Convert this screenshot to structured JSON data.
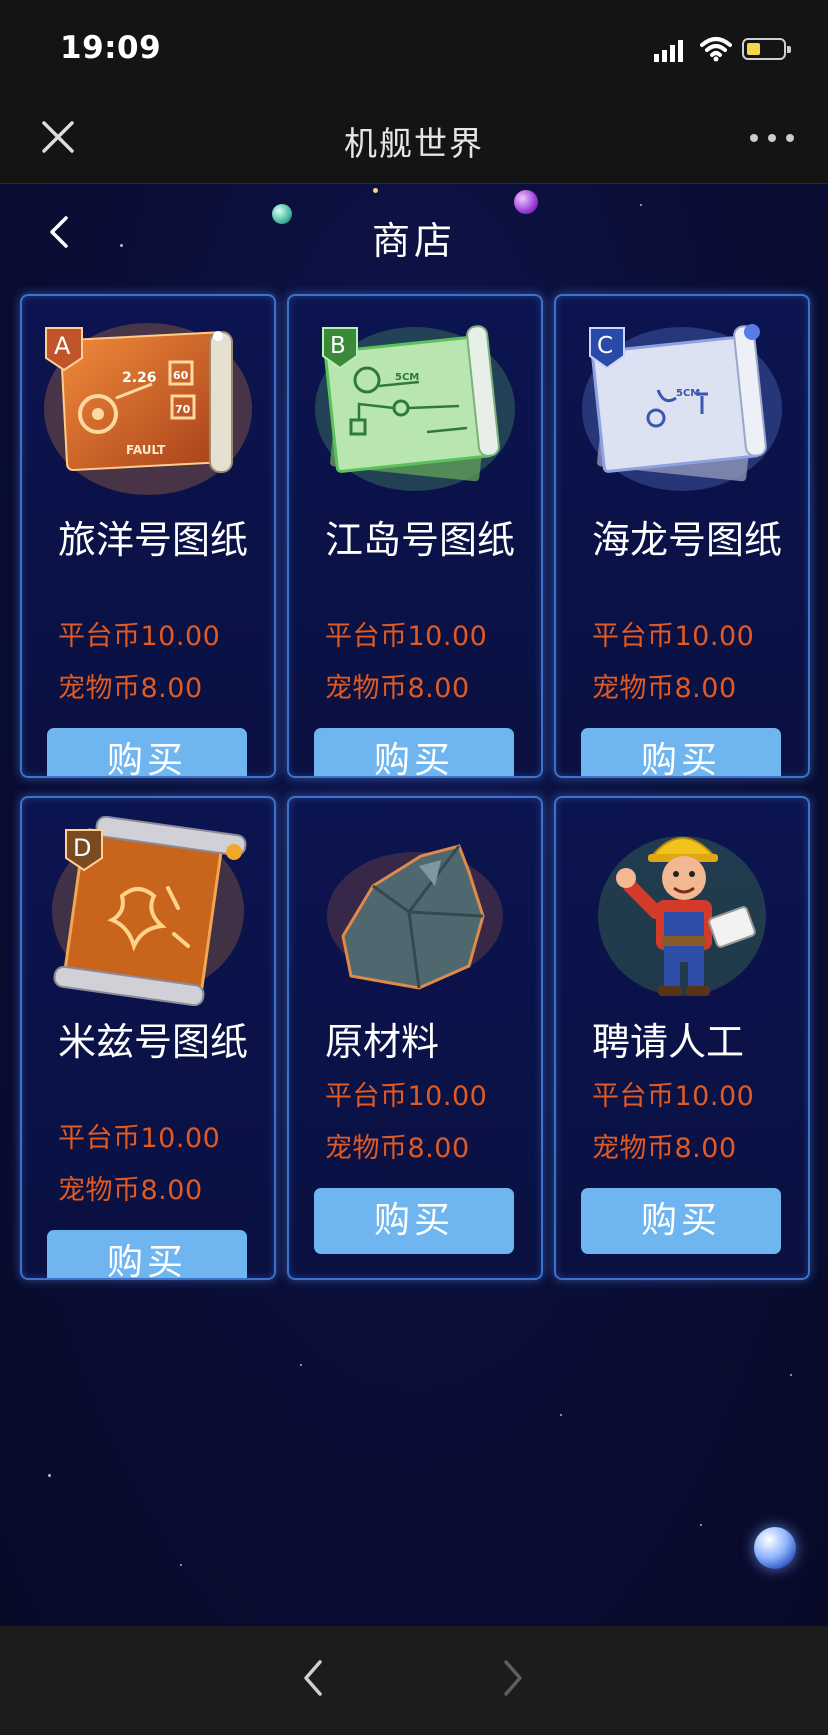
{
  "status": {
    "time": "19:09"
  },
  "nav": {
    "title": "机舰世界"
  },
  "shop": {
    "title": "商店"
  },
  "items": [
    {
      "name": "旅洋号图纸",
      "badge": "A",
      "price_platform": "平台币10.00",
      "price_pet": "宠物币8.00",
      "buy_label": "购买",
      "art": "blueprint-orange"
    },
    {
      "name": "江岛号图纸",
      "badge": "B",
      "price_platform": "平台币10.00",
      "price_pet": "宠物币8.00",
      "buy_label": "购买",
      "art": "blueprint-green"
    },
    {
      "name": "海龙号图纸",
      "badge": "C",
      "price_platform": "平台币10.00",
      "price_pet": "宠物币8.00",
      "buy_label": "购买",
      "art": "blueprint-blue"
    },
    {
      "name": "米兹号图纸",
      "badge": "D",
      "price_platform": "平台币10.00",
      "price_pet": "宠物币8.00",
      "buy_label": "购买",
      "art": "blueprint-gold"
    },
    {
      "name": "原材料",
      "price_platform": "平台币10.00",
      "price_pet": "宠物币8.00",
      "buy_label": "购买",
      "art": "raw-ore"
    },
    {
      "name": "聘请人工",
      "price_platform": "平台币10.00",
      "price_pet": "宠物币8.00",
      "buy_label": "购买",
      "art": "worker"
    }
  ],
  "blueprint_marks": {
    "a_number": "2.26",
    "a_badge1": "60",
    "a_badge2": "70",
    "a_footer": "FAULT",
    "scale": "5CM"
  }
}
